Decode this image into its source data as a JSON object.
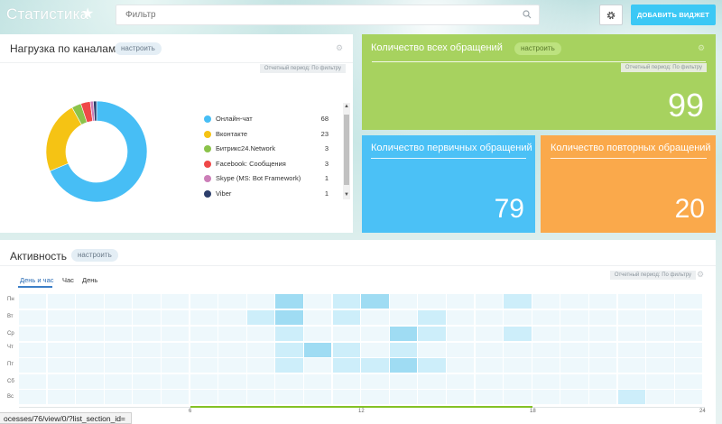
{
  "header": {
    "title": "Статистика",
    "filter_placeholder": "Фильтр",
    "add_widget_label": "ДОБАВИТЬ ВИДЖЕТ"
  },
  "channels_widget": {
    "title": "Нагрузка по каналам",
    "configure_label": "настроить",
    "period_label": "Отчетный период: По фильтру",
    "chart_data": {
      "type": "pie",
      "categories": [
        "Онлайн-чат",
        "Вконтакте",
        "Битрикс24.Network",
        "Facebook: Сообщения",
        "Skype (MS: Bot Framework)",
        "Viber"
      ],
      "values": [
        68,
        23,
        3,
        3,
        1,
        1
      ],
      "colors": [
        "#47bef5",
        "#f5c314",
        "#8bc34a",
        "#ef4848",
        "#cc7fb8",
        "#2c3e6b"
      ]
    }
  },
  "total_widget": {
    "title": "Количество всех обращений",
    "configure_label": "настроить",
    "period_label": "Отчетный период: По фильтру",
    "value": "99",
    "color": "#a7d25f"
  },
  "first_widget": {
    "title": "Количество первичных обращений",
    "value": "79",
    "color": "#4bc1f6"
  },
  "repeat_widget": {
    "title": "Количество повторных обращений",
    "value": "20",
    "color": "#faa94b"
  },
  "activity_widget": {
    "title": "Активность",
    "configure_label": "настроить",
    "period_label": "Отчетный период: По фильтру",
    "tabs": [
      "День и час",
      "Час",
      "День"
    ],
    "days": [
      "Пн",
      "Вт",
      "Ср",
      "Чт",
      "Пт",
      "Сб",
      "Вс"
    ],
    "axis_labels": [
      "6",
      "12",
      "18",
      "24"
    ],
    "chart_data": {
      "type": "heatmap",
      "rows": [
        "Пн",
        "Вт",
        "Ср",
        "Чт",
        "Пт",
        "Сб",
        "Вс"
      ],
      "columns": [
        1,
        2,
        3,
        4,
        5,
        6,
        7,
        8,
        9,
        10,
        11,
        12,
        13,
        14,
        15,
        16,
        17,
        18,
        19,
        20,
        21,
        22,
        23,
        24
      ],
      "intensity": [
        [
          0,
          0,
          0,
          0,
          0,
          0,
          0,
          0,
          0,
          2,
          0,
          1,
          2,
          0,
          0,
          0,
          0,
          1,
          0,
          0,
          0,
          0,
          0,
          0
        ],
        [
          0,
          0,
          0,
          0,
          0,
          0,
          0,
          0,
          1,
          2,
          0,
          1,
          0,
          0,
          1,
          0,
          0,
          0,
          0,
          0,
          0,
          0,
          0,
          0
        ],
        [
          0,
          0,
          0,
          0,
          0,
          0,
          0,
          0,
          0,
          1,
          0,
          0,
          0,
          2,
          1,
          0,
          0,
          1,
          0,
          0,
          0,
          0,
          0,
          0
        ],
        [
          0,
          0,
          0,
          0,
          0,
          0,
          0,
          0,
          0,
          1,
          2,
          1,
          0,
          1,
          0,
          0,
          0,
          0,
          0,
          0,
          0,
          0,
          0,
          0
        ],
        [
          0,
          0,
          0,
          0,
          0,
          0,
          0,
          0,
          0,
          1,
          0,
          1,
          1,
          2,
          1,
          0,
          0,
          0,
          0,
          0,
          0,
          0,
          0,
          0
        ],
        [
          0,
          0,
          0,
          0,
          0,
          0,
          0,
          0,
          0,
          0,
          0,
          0,
          0,
          0,
          0,
          0,
          0,
          0,
          0,
          0,
          0,
          0,
          0,
          0
        ],
        [
          0,
          0,
          0,
          0,
          0,
          0,
          0,
          0,
          0,
          0,
          0,
          0,
          0,
          0,
          0,
          0,
          0,
          0,
          0,
          0,
          0,
          1,
          0,
          0
        ]
      ],
      "colors": [
        "#eef8fc",
        "#cdeefa",
        "#9fdcf3"
      ]
    }
  },
  "status_bar": {
    "url": "ocesses/76/view/0/?list_section_id="
  }
}
